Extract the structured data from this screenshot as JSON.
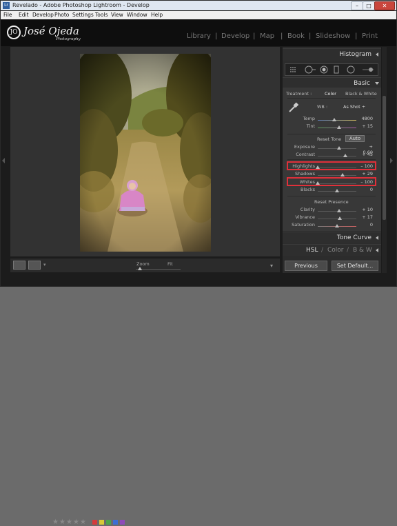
{
  "window": {
    "title": "Revelado - Adobe Photoshop Lightroom - Develop"
  },
  "menu": [
    "File",
    "Edit",
    "Develop",
    "Photo",
    "Settings",
    "Tools",
    "View",
    "Window",
    "Help"
  ],
  "identity": {
    "name": "José Ojeda",
    "subtitle": "Photography",
    "mark": "JO"
  },
  "modules": [
    "Library",
    "Develop",
    "Map",
    "Book",
    "Slideshow",
    "Print"
  ],
  "modules_separator": "|",
  "panels": {
    "histogram": "Histogram",
    "basic": "Basic",
    "tone_curve": "Tone Curve",
    "hsl": "HSL",
    "color": "Color",
    "bw": "B & W"
  },
  "treatment": {
    "label": "Treatment :",
    "color": "Color",
    "bw": "Black & White"
  },
  "wb": {
    "label": "WB :",
    "value": "As Shot ÷"
  },
  "sliders": {
    "temp": {
      "label": "Temp",
      "value": "4800",
      "pos": 0.42
    },
    "tint": {
      "label": "Tint",
      "value": "+ 15",
      "pos": 0.56
    },
    "exposure": {
      "label": "Exposure",
      "value": "+ 0.60",
      "pos": 0.56
    },
    "contrast": {
      "label": "Contrast",
      "value": "+ 45",
      "pos": 0.72
    },
    "highlights": {
      "label": "Highlights",
      "value": "– 100",
      "pos": 0.0
    },
    "shadows": {
      "label": "Shadows",
      "value": "+ 29",
      "pos": 0.64
    },
    "whites": {
      "label": "Whites",
      "value": "– 100",
      "pos": 0.0
    },
    "blacks": {
      "label": "Blacks",
      "value": "0",
      "pos": 0.5
    },
    "clarity": {
      "label": "Clarity",
      "value": "+ 10",
      "pos": 0.55
    },
    "vibrance": {
      "label": "Vibrance",
      "value": "+ 17",
      "pos": 0.58
    },
    "saturation": {
      "label": "Saturation",
      "value": "0",
      "pos": 0.5
    }
  },
  "tone": {
    "reset": "Reset Tone",
    "auto": "Auto"
  },
  "presence": {
    "reset": "Reset Presence"
  },
  "toolbar": {
    "zoom": "Zoom",
    "fit": "Fit"
  },
  "buttons": {
    "previous": "Previous",
    "set_default": "Set Default..."
  },
  "colors": {
    "accent": "#e0303a",
    "panel": "#383838"
  }
}
